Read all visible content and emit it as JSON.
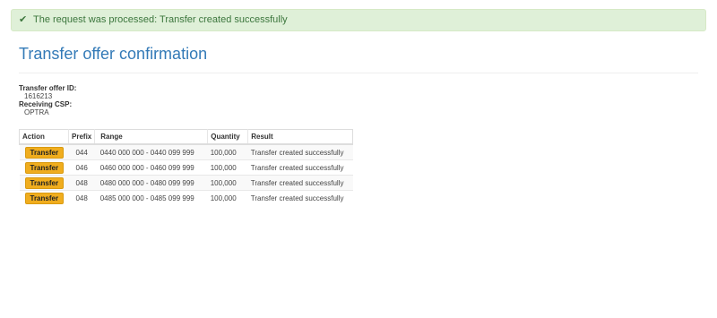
{
  "alert": {
    "icon": "check-icon",
    "text": "The request was processed: Transfer created successfully"
  },
  "page": {
    "title": "Transfer offer confirmation"
  },
  "offer": {
    "id_label": "Transfer offer ID:",
    "id_value": "1616213",
    "csp_label": "Receiving CSP:",
    "csp_value": "OPTRA"
  },
  "table": {
    "headers": [
      "Action",
      "Prefix",
      "Range",
      "Quantity",
      "Result"
    ],
    "rows": [
      {
        "action": "Transfer",
        "prefix": "044",
        "range": "0440 000 000 - 0440 099 999",
        "quantity": "100,000",
        "result": "Transfer created successfully"
      },
      {
        "action": "Transfer",
        "prefix": "046",
        "range": "0460 000 000 - 0460 099 999",
        "quantity": "100,000",
        "result": "Transfer created successfully"
      },
      {
        "action": "Transfer",
        "prefix": "048",
        "range": "0480 000 000 - 0480 099 999",
        "quantity": "100,000",
        "result": "Transfer created successfully"
      },
      {
        "action": "Transfer",
        "prefix": "048",
        "range": "0485 000 000 - 0485 099 999",
        "quantity": "100,000",
        "result": "Transfer created successfully"
      }
    ]
  },
  "colors": {
    "alert_bg": "#dff0d8",
    "alert_text": "#3c763d",
    "title": "#337ab7",
    "button": "#f0ad1e"
  }
}
